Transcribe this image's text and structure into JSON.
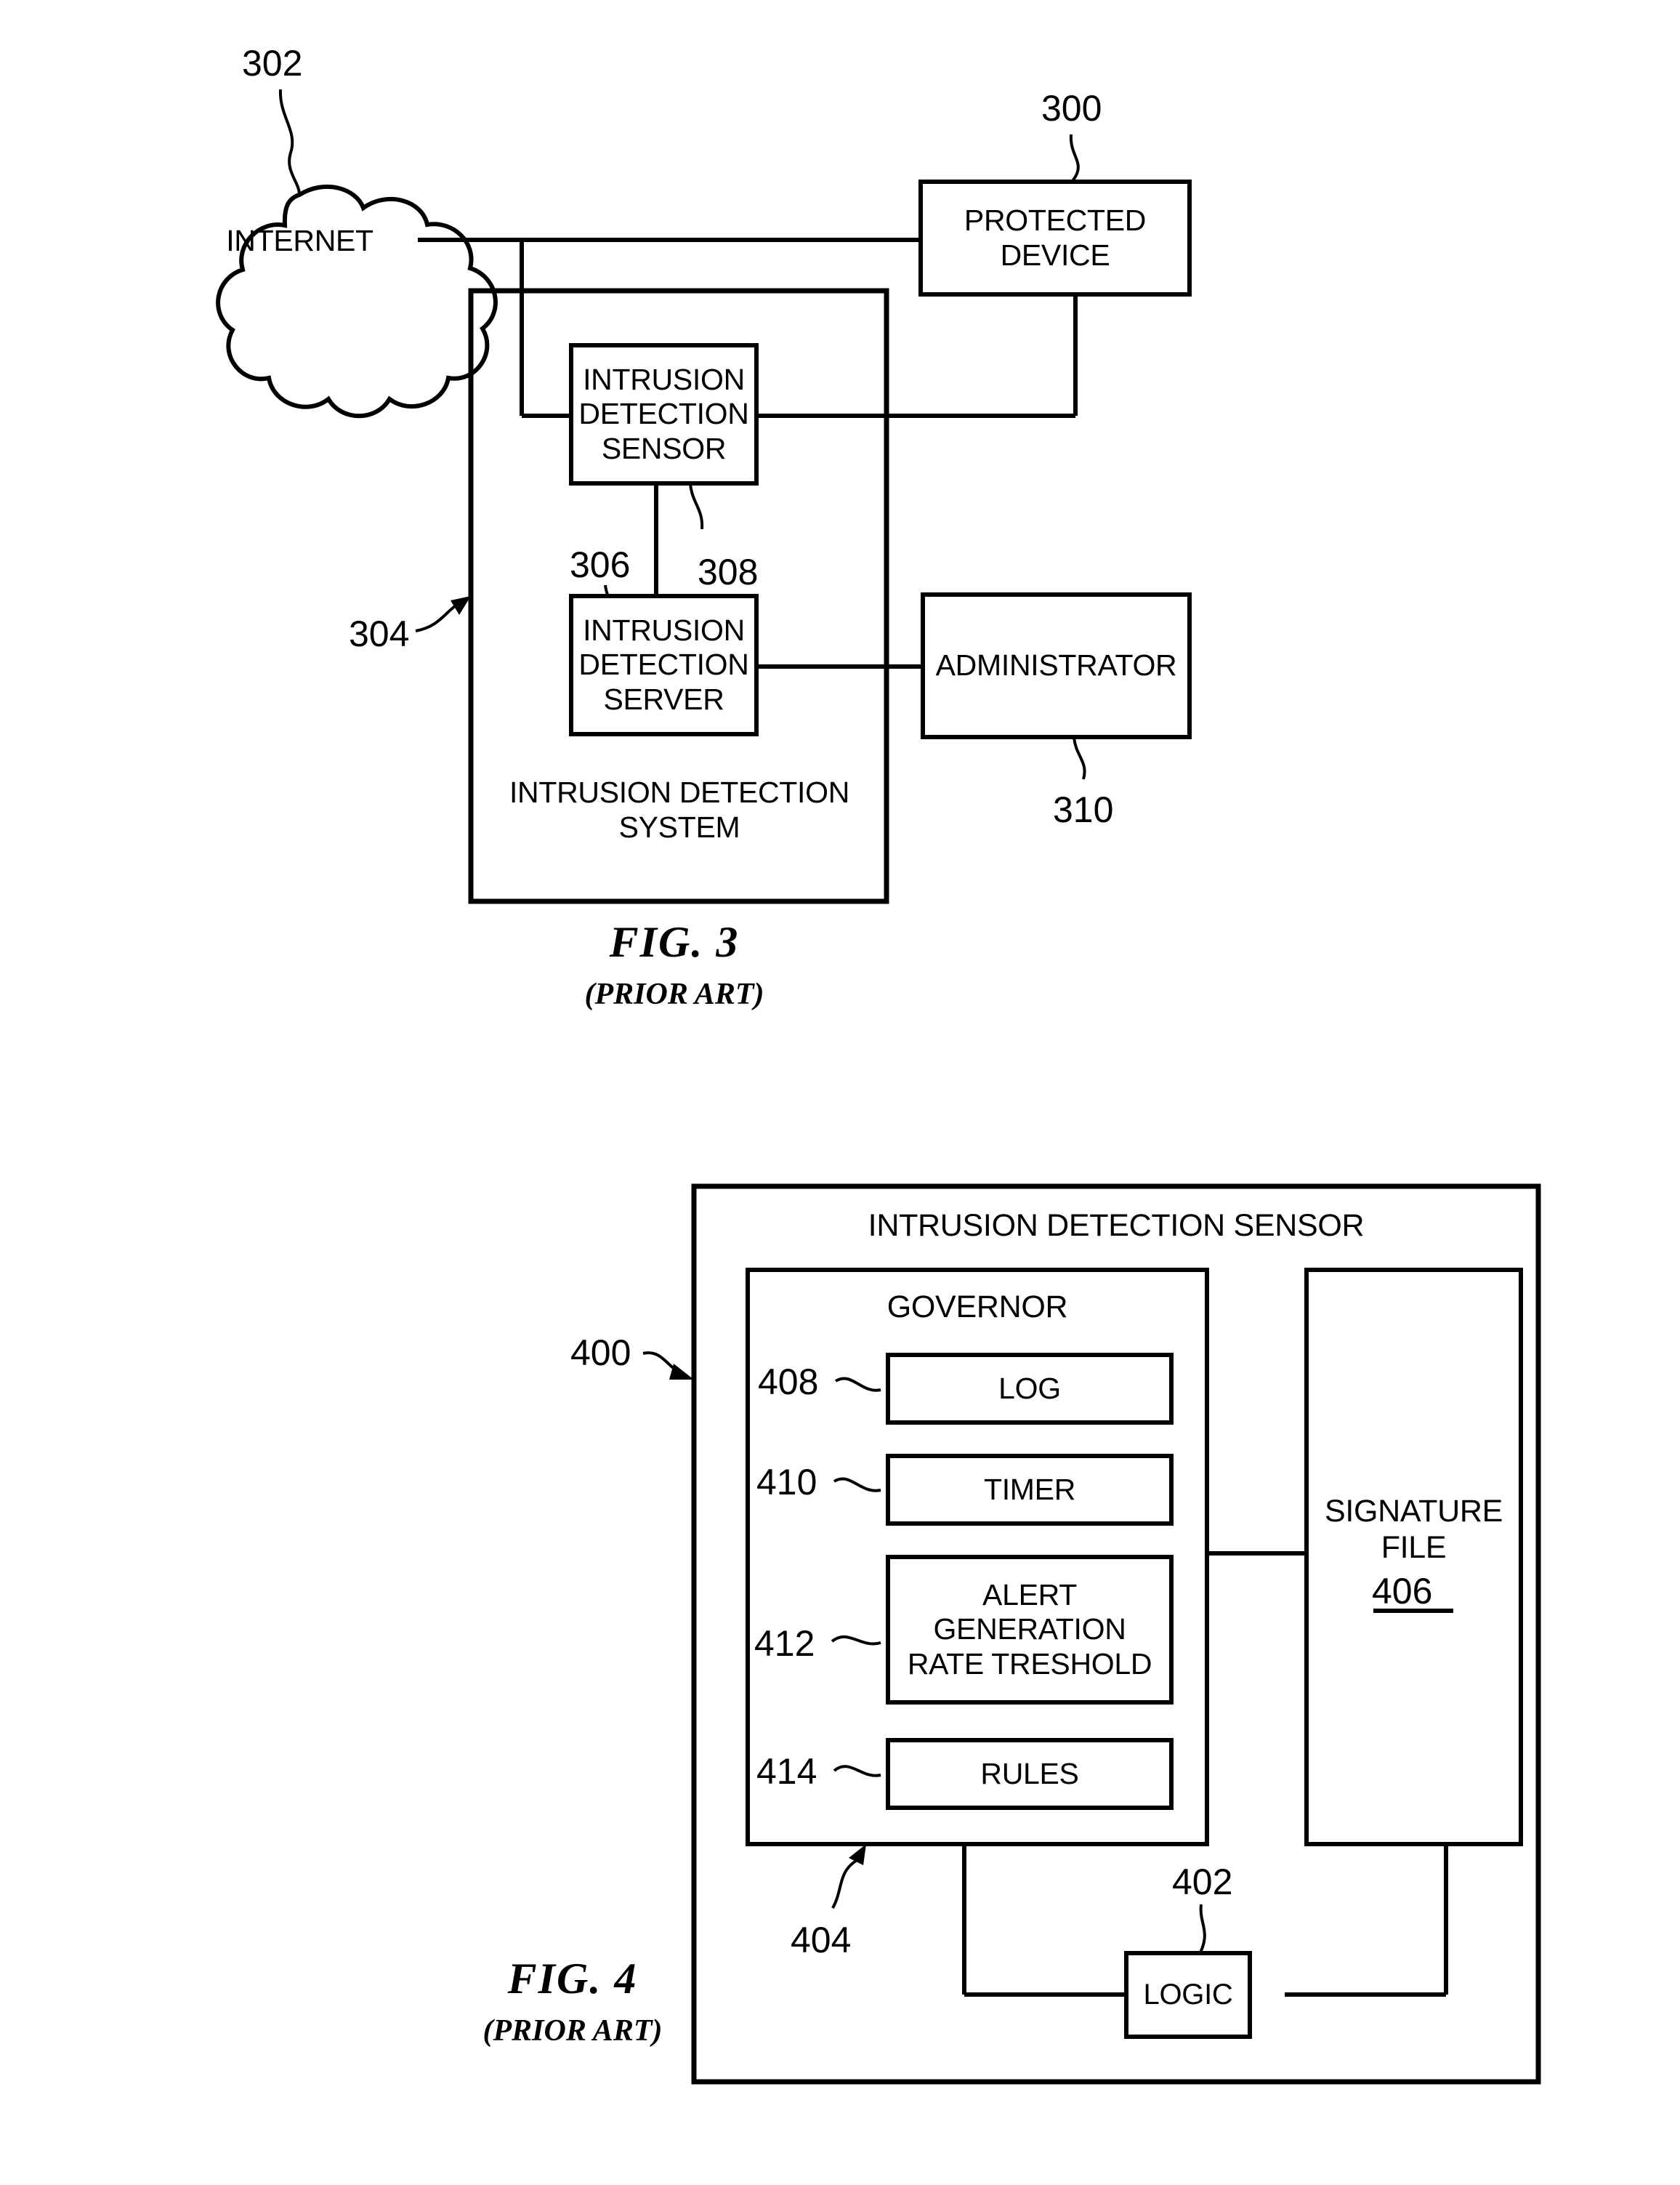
{
  "document": {
    "type": "patent-drawing-sheet",
    "background_color": "#ffffff",
    "line_color": "#000000"
  },
  "figure3": {
    "caption": "FIG. 3",
    "subcaption": "(PRIOR ART)",
    "nodes": {
      "internet": {
        "label": "INTERNET",
        "ref": "302"
      },
      "protected_device": {
        "label": "PROTECTED\nDEVICE",
        "ref": "300"
      },
      "intrusion_detection_sensor": {
        "label": "INTRUSION\nDETECTION\nSENSOR",
        "ref": "308"
      },
      "intrusion_detection_server": {
        "label": "INTRUSION\nDETECTION\nSERVER",
        "ref": "306"
      },
      "administrator": {
        "label": "ADMINISTRATOR",
        "ref": "310"
      },
      "intrusion_detection_system": {
        "label": "INTRUSION DETECTION\nSYSTEM",
        "ref": "304"
      }
    }
  },
  "figure4": {
    "caption": "FIG. 4",
    "subcaption": "(PRIOR ART)",
    "nodes": {
      "intrusion_detection_sensor": {
        "label": "INTRUSION DETECTION SENSOR",
        "ref": "400"
      },
      "governor": {
        "label": "GOVERNOR",
        "ref": "404"
      },
      "log": {
        "label": "LOG",
        "ref": "408"
      },
      "timer": {
        "label": "TIMER",
        "ref": "410"
      },
      "alert_generation_rate_threshold": {
        "label": "ALERT\nGENERATION\nRATE TRESHOLD",
        "ref": "412"
      },
      "rules": {
        "label": "RULES",
        "ref": "414"
      },
      "signature_file": {
        "label": "SIGNATURE\nFILE",
        "ref": "406"
      },
      "logic": {
        "label": "LOGIC",
        "ref": "402"
      }
    }
  }
}
